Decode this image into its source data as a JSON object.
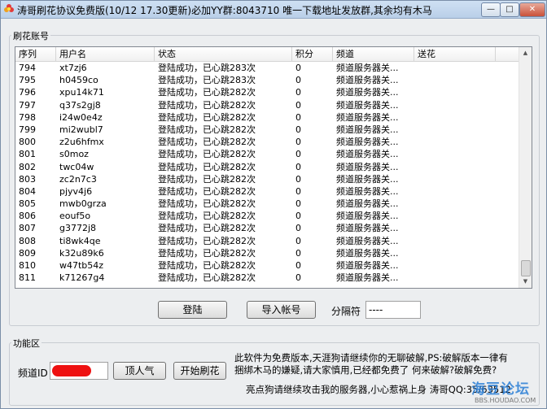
{
  "window": {
    "title": "涛哥刷花协议免费版(10/12 17.30更新)必加YY群:8043710 唯一下载地址发放群,其余均有木马",
    "minimize_label": "—",
    "maximize_label": "□",
    "close_label": "✕"
  },
  "accounts_group": {
    "label": "刷花账号",
    "columns": [
      "序列",
      "用户名",
      "状态",
      "积分",
      "频道",
      "送花"
    ],
    "rows": [
      {
        "seq": "794",
        "user": "xt7zj6",
        "status": "登陆成功，已心跳283次",
        "points": "0",
        "channel": "频道服务器关...",
        "flower": ""
      },
      {
        "seq": "795",
        "user": "h0459co",
        "status": "登陆成功，已心跳283次",
        "points": "0",
        "channel": "频道服务器关...",
        "flower": ""
      },
      {
        "seq": "796",
        "user": "xpu14k71",
        "status": "登陆成功，已心跳282次",
        "points": "0",
        "channel": "频道服务器关...",
        "flower": ""
      },
      {
        "seq": "797",
        "user": "q37s2gj8",
        "status": "登陆成功，已心跳282次",
        "points": "0",
        "channel": "频道服务器关...",
        "flower": ""
      },
      {
        "seq": "798",
        "user": "i24w0e4z",
        "status": "登陆成功，已心跳282次",
        "points": "0",
        "channel": "频道服务器关...",
        "flower": ""
      },
      {
        "seq": "799",
        "user": "mi2wubl7",
        "status": "登陆成功，已心跳282次",
        "points": "0",
        "channel": "频道服务器关...",
        "flower": ""
      },
      {
        "seq": "800",
        "user": "z2u6hfmx",
        "status": "登陆成功，已心跳282次",
        "points": "0",
        "channel": "频道服务器关...",
        "flower": ""
      },
      {
        "seq": "801",
        "user": "s0moz",
        "status": "登陆成功，已心跳282次",
        "points": "0",
        "channel": "频道服务器关...",
        "flower": ""
      },
      {
        "seq": "802",
        "user": "twc04w",
        "status": "登陆成功，已心跳282次",
        "points": "0",
        "channel": "频道服务器关...",
        "flower": ""
      },
      {
        "seq": "803",
        "user": "zc2n7c3",
        "status": "登陆成功，已心跳282次",
        "points": "0",
        "channel": "频道服务器关...",
        "flower": ""
      },
      {
        "seq": "804",
        "user": "pjyv4j6",
        "status": "登陆成功，已心跳282次",
        "points": "0",
        "channel": "频道服务器关...",
        "flower": ""
      },
      {
        "seq": "805",
        "user": "mwb0grza",
        "status": "登陆成功，已心跳282次",
        "points": "0",
        "channel": "频道服务器关...",
        "flower": ""
      },
      {
        "seq": "806",
        "user": "eouf5o",
        "status": "登陆成功，已心跳282次",
        "points": "0",
        "channel": "频道服务器关...",
        "flower": ""
      },
      {
        "seq": "807",
        "user": "g3772j8",
        "status": "登陆成功，已心跳282次",
        "points": "0",
        "channel": "频道服务器关...",
        "flower": ""
      },
      {
        "seq": "808",
        "user": "ti8wk4qe",
        "status": "登陆成功，已心跳282次",
        "points": "0",
        "channel": "频道服务器关...",
        "flower": ""
      },
      {
        "seq": "809",
        "user": "k32u89k6",
        "status": "登陆成功，已心跳282次",
        "points": "0",
        "channel": "频道服务器关...",
        "flower": ""
      },
      {
        "seq": "810",
        "user": "w47tb54z",
        "status": "登陆成功，已心跳282次",
        "points": "0",
        "channel": "频道服务器关...",
        "flower": ""
      },
      {
        "seq": "811",
        "user": "k71267g4",
        "status": "登陆成功，已心跳282次",
        "points": "0",
        "channel": "频道服务器关...",
        "flower": ""
      }
    ],
    "login_button": "登陆",
    "import_button": "导入帐号",
    "separator_label": "分隔符",
    "separator_value": "----"
  },
  "functions_group": {
    "label": "功能区",
    "channel_id_label": "频道ID",
    "popularity_button": "顶人气",
    "start_flower_button": "开始刷花",
    "notice_line1": "此软件为免费版本,天涯狗请继续你的无聊破解,PS:破解版本一律有",
    "notice_line2": "捆绑木马的嫌疑,请大家慎用,已经都免费了 何来破解?破解免费?",
    "notice_line3": "亮点狗请继续攻击我的服务器,小心惹祸上身 涛哥QQ:35/63512"
  },
  "watermark": {
    "main": "海豆论坛",
    "sub": "BBS.HOUDAO.COM"
  },
  "colors": {
    "accent_blue": "#2b7fd6",
    "redaction": "#ee1111"
  }
}
